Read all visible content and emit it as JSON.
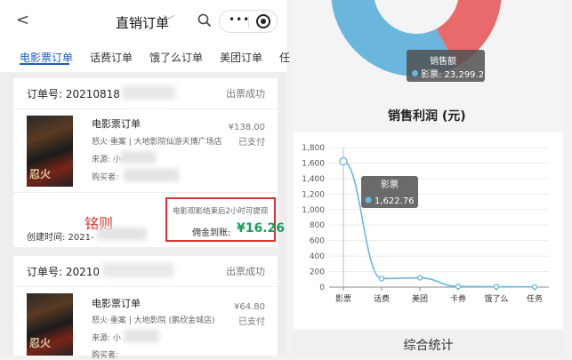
{
  "header": {
    "title": "直销订单",
    "back_glyph": "<",
    "chevron_glyph": "﹀",
    "capsule_dots": "•••"
  },
  "tabs": [
    {
      "label": "电影票订单",
      "active": true
    },
    {
      "label": "话费订单"
    },
    {
      "label": "饿了么订单"
    },
    {
      "label": "美团订单"
    },
    {
      "label": "任"
    }
  ],
  "orders": [
    {
      "order_no_label": "订单号: 20210818",
      "status": "出票成功",
      "product": "电影票订单",
      "detail": "怒火·重案 | 大地影院仙游天博广场店",
      "source_label": "来源: 小",
      "buyer_label": "购买者:",
      "price": "¥138.00",
      "paid": "已支付",
      "notice": "电影观影结束后2小时可提现",
      "commission_label": "佣金到账:",
      "commission_value": "¥16.26",
      "create_time_label": "创建时间: 2021-",
      "poster_text": "忍火"
    },
    {
      "order_no_label": "订单号: 20210",
      "status": "出票成功",
      "product": "电影票订单",
      "detail": "怒火·重案 | 大地影院 (鹏欣金城店)",
      "source_label": "来源: 小",
      "buyer_label": "购买者:",
      "price": "¥64.80",
      "paid": "已支付",
      "poster_text": "忍火"
    }
  ],
  "watermark": "铭则",
  "donut": {
    "tooltip_title": "销售额",
    "tooltip_value": "影票: 23,299.2",
    "colors": {
      "blue": "#6ab6dc",
      "red": "#e86a6a"
    }
  },
  "chart_data": {
    "type": "line",
    "title": "销售利润 (元)",
    "categories": [
      "影票",
      "话费",
      "美团",
      "卡券",
      "饿了么",
      "任务"
    ],
    "series": [
      {
        "values": [
          1622.76,
          110,
          120,
          8,
          5,
          3
        ]
      }
    ],
    "ylim": [
      0,
      1800
    ],
    "yticks": [
      0,
      200,
      400,
      600,
      800,
      1000,
      1200,
      1400,
      1600,
      1800
    ],
    "ytick_labels": [
      "0",
      "200",
      "400",
      "600",
      "800",
      "1,000",
      "1,200",
      "1,400",
      "1,600",
      "1,800"
    ],
    "tooltip": {
      "title": "影票",
      "value": "1,622.76"
    },
    "line_color": "#6ab6dc"
  },
  "bottom": {
    "title": "综合统计"
  }
}
